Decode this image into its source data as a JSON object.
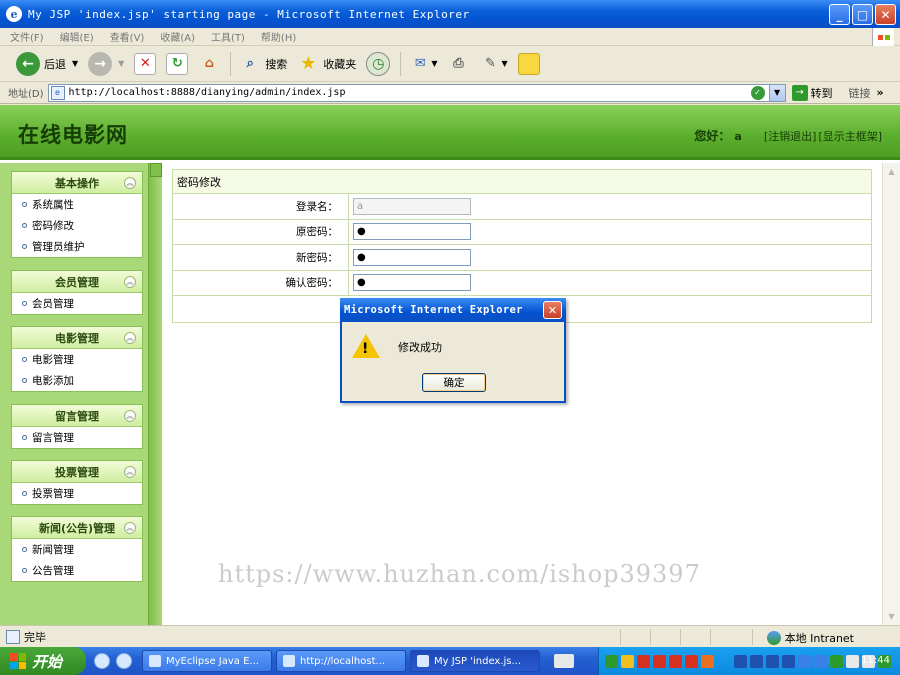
{
  "window": {
    "title": "My JSP 'index.jsp' starting page - Microsoft Internet Explorer"
  },
  "menu": [
    "文件(F)",
    "编辑(E)",
    "查看(V)",
    "收藏(A)",
    "工具(T)",
    "帮助(H)"
  ],
  "toolbar": {
    "back_label": "后退",
    "search_label": "搜索",
    "favorites_label": "收藏夹"
  },
  "address": {
    "label": "地址(D)",
    "url": "http://localhost:8888/dianying/admin/index.jsp",
    "go_label": "转到",
    "links_label": "链接"
  },
  "header": {
    "site_title": "在线电影网",
    "greeting": "您好：",
    "username": "a",
    "logout_link": "[注销退出]",
    "show_frame_link": "[显示主框架]"
  },
  "sidebar": {
    "groups": [
      {
        "title": "基本操作",
        "items": [
          "系统属性",
          "密码修改",
          "管理员维护"
        ]
      },
      {
        "title": "会员管理",
        "items": [
          "会员管理"
        ]
      },
      {
        "title": "电影管理",
        "items": [
          "电影管理",
          "电影添加"
        ]
      },
      {
        "title": "留言管理",
        "items": [
          "留言管理"
        ]
      },
      {
        "title": "投票管理",
        "items": [
          "投票管理"
        ]
      },
      {
        "title": "新闻(公告)管理",
        "items": [
          "新闻管理",
          "公告管理"
        ]
      }
    ]
  },
  "form": {
    "title": "密码修改",
    "fields": [
      {
        "label": "登录名：",
        "value": "a"
      },
      {
        "label": "原密码：",
        "value": "●"
      },
      {
        "label": "新密码：",
        "value": "●"
      },
      {
        "label": "确认密码：",
        "value": "●"
      }
    ]
  },
  "dialog": {
    "title": "Microsoft Internet Explorer",
    "message": "修改成功",
    "ok_label": "确定"
  },
  "watermark": "https://www.huzhan.com/ishop39397",
  "status": {
    "text": "完毕",
    "zone": "本地 Intranet"
  },
  "taskbar": {
    "start_label": "开始",
    "tasks": [
      "MyEclipse Java E...",
      "http://localhost...",
      "My JSP 'index.js..."
    ],
    "clock": "11:44"
  },
  "colors": {
    "header_green": "#5cae2e",
    "sidebar_green": "#a8d878",
    "xp_blue": "#0a5fd8"
  }
}
